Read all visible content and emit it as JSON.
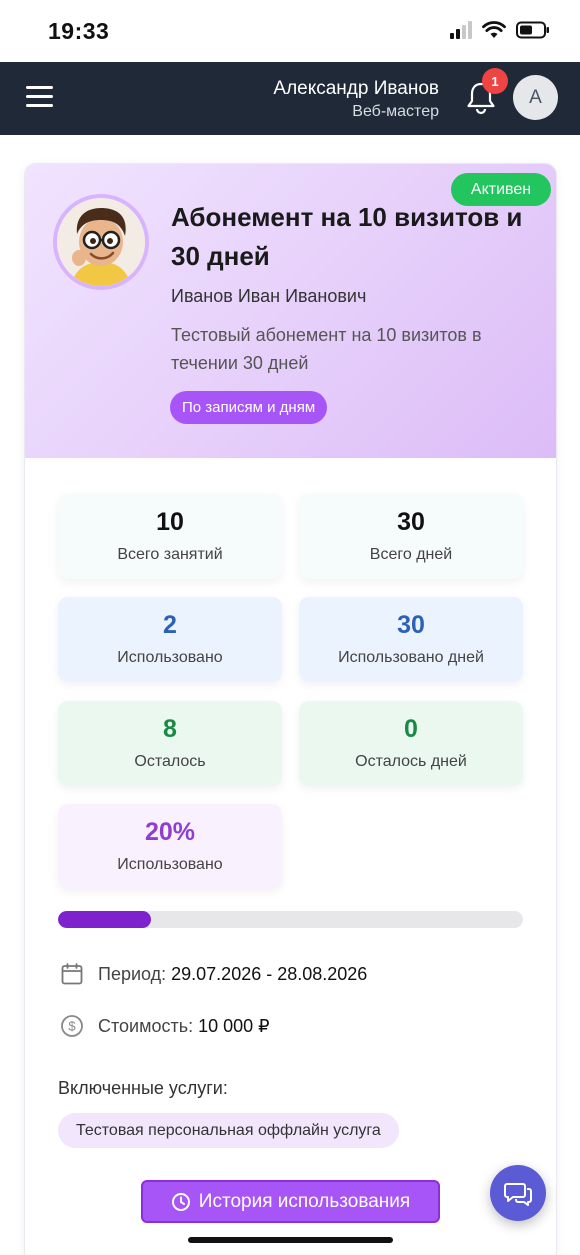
{
  "status_bar": {
    "time": "19:33"
  },
  "header": {
    "user_name": "Александр Иванов",
    "user_role": "Веб-мастер",
    "notifications_count": "1",
    "avatar_letter": "A"
  },
  "subscription": {
    "status": "Активен",
    "title": "Абонемент на 10 визитов и 30 дней",
    "owner": "Иванов Иван Иванович",
    "description": "Тестовый абонемент на 10 визитов в течении 30 дней",
    "type": "По записям и дням"
  },
  "stats": [
    {
      "value": "10",
      "label": "Всего занятий"
    },
    {
      "value": "30",
      "label": "Всего дней"
    },
    {
      "value": "2",
      "label": "Использовано"
    },
    {
      "value": "30",
      "label": "Использовано дней"
    },
    {
      "value": "8",
      "label": "Осталось"
    },
    {
      "value": "0",
      "label": "Осталось дней"
    },
    {
      "value": "20%",
      "label": "Использовано"
    }
  ],
  "progress": {
    "used_fraction": 0.2
  },
  "details": {
    "period_label": "Период:",
    "period_value": "29.07.2026 - 28.08.2026",
    "cost_label": "Стоимость:",
    "cost_value": "10 000 ₽"
  },
  "services": {
    "title": "Включенные услуги:",
    "items": [
      "Тестовая персональная оффлайн услуга"
    ]
  },
  "actions": {
    "history_label": "История использования"
  },
  "colors": {
    "nav_bg": "#1f2937",
    "accent_purple": "#a855f7",
    "progress_fill": "#7e22ce",
    "active_green": "#22c55e",
    "badge_red": "#ef4444",
    "chat_fab": "#5b5bd6"
  },
  "icons": {
    "menu": "hamburger-icon",
    "notifications": "bell-icon",
    "period": "calendar-icon",
    "cost": "dollar-icon",
    "history": "clock-icon",
    "chat": "chat-icon"
  }
}
